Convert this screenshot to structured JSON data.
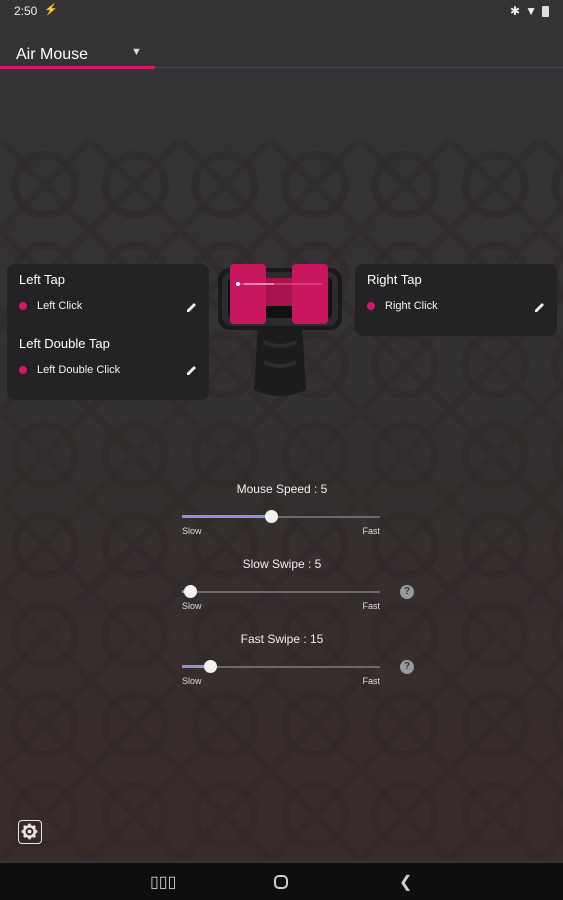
{
  "status": {
    "time": "2:50"
  },
  "header": {
    "title": "Air Mouse"
  },
  "cards": {
    "left": {
      "tap_title": "Left Tap",
      "tap_action": "Left Click",
      "double_title": "Left Double Tap",
      "double_action": "Left Double Click"
    },
    "right": {
      "tap_title": "Right Tap",
      "tap_action": "Right Click"
    }
  },
  "sliders": {
    "mouse_speed": {
      "label": "Mouse Speed : 5",
      "value": 5,
      "fraction": 0.45,
      "slow": "Slow",
      "fast": "Fast"
    },
    "slow_swipe": {
      "label": "Slow Swipe : 5",
      "value": 5,
      "fraction": 0.04,
      "slow": "Slow",
      "fast": "Fast"
    },
    "fast_swipe": {
      "label": "Fast Swipe : 15",
      "value": 15,
      "fraction": 0.14,
      "slow": "Slow",
      "fast": "Fast"
    }
  },
  "help_glyph": "?",
  "colors": {
    "accent": "#d4176a",
    "slider_fill": "#8b93e0",
    "card": "#232325",
    "background": "#333336"
  },
  "icons": {
    "edit": "pencil-icon",
    "settings": "gear-icon",
    "help": "help-circle-icon"
  }
}
